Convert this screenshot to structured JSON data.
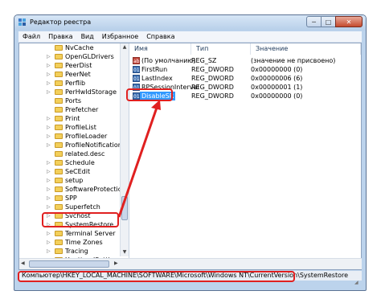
{
  "window": {
    "title": "Редактор реестра",
    "buttons": {
      "minimize": "─",
      "maximize": "□",
      "close": "✕"
    }
  },
  "menu": [
    "Файл",
    "Правка",
    "Вид",
    "Избранное",
    "Справка"
  ],
  "tree": {
    "items": [
      {
        "label": "NvCache",
        "expandable": false
      },
      {
        "label": "OpenGLDrivers",
        "expandable": true
      },
      {
        "label": "PeerDist",
        "expandable": true
      },
      {
        "label": "PeerNet",
        "expandable": true
      },
      {
        "label": "Perflib",
        "expandable": true
      },
      {
        "label": "PerHwIdStorage",
        "expandable": true
      },
      {
        "label": "Ports",
        "expandable": false
      },
      {
        "label": "Prefetcher",
        "expandable": false
      },
      {
        "label": "Print",
        "expandable": true
      },
      {
        "label": "ProfileList",
        "expandable": true
      },
      {
        "label": "ProfileLoader",
        "expandable": true
      },
      {
        "label": "ProfileNotification",
        "expandable": true
      },
      {
        "label": "related.desc",
        "expandable": false
      },
      {
        "label": "Schedule",
        "expandable": true
      },
      {
        "label": "SeCEdit",
        "expandable": true
      },
      {
        "label": "setup",
        "expandable": true
      },
      {
        "label": "SoftwareProtectionPl",
        "expandable": true
      },
      {
        "label": "SPP",
        "expandable": true
      },
      {
        "label": "Superfetch",
        "expandable": true
      },
      {
        "label": "Svchost",
        "expandable": true
      },
      {
        "label": "SystemRestore",
        "expandable": true,
        "selected": true
      },
      {
        "label": "Terminal Server",
        "expandable": true
      },
      {
        "label": "Time Zones",
        "expandable": true
      },
      {
        "label": "Tracing",
        "expandable": true
      },
      {
        "label": "UnattendSettings",
        "expandable": true
      }
    ]
  },
  "list": {
    "columns": [
      "Имя",
      "Тип",
      "Значение"
    ],
    "rows": [
      {
        "icon": "string-value-icon",
        "name": "(По умолчанию)",
        "type": "REG_SZ",
        "value": "(значение не присвоено)"
      },
      {
        "icon": "dword-value-icon",
        "name": "FirstRun",
        "type": "REG_DWORD",
        "value": "0x00000000 (0)"
      },
      {
        "icon": "dword-value-icon",
        "name": "LastIndex",
        "type": "REG_DWORD",
        "value": "0x00000006 (6)"
      },
      {
        "icon": "dword-value-icon",
        "name": "RPSessionInterval",
        "type": "REG_DWORD",
        "value": "0x00000001 (1)"
      },
      {
        "icon": "dword-value-icon",
        "name": "DisableSR",
        "type": "REG_DWORD",
        "value": "0x00000000 (0)",
        "selected": true
      }
    ]
  },
  "status": {
    "path": "Компьютер\\HKEY_LOCAL_MACHINE\\SOFTWARE\\Microsoft\\Windows NT\\CurrentVersion\\SystemRestore"
  },
  "colors": {
    "highlight": "#e02020",
    "selection": "#3399ff"
  }
}
